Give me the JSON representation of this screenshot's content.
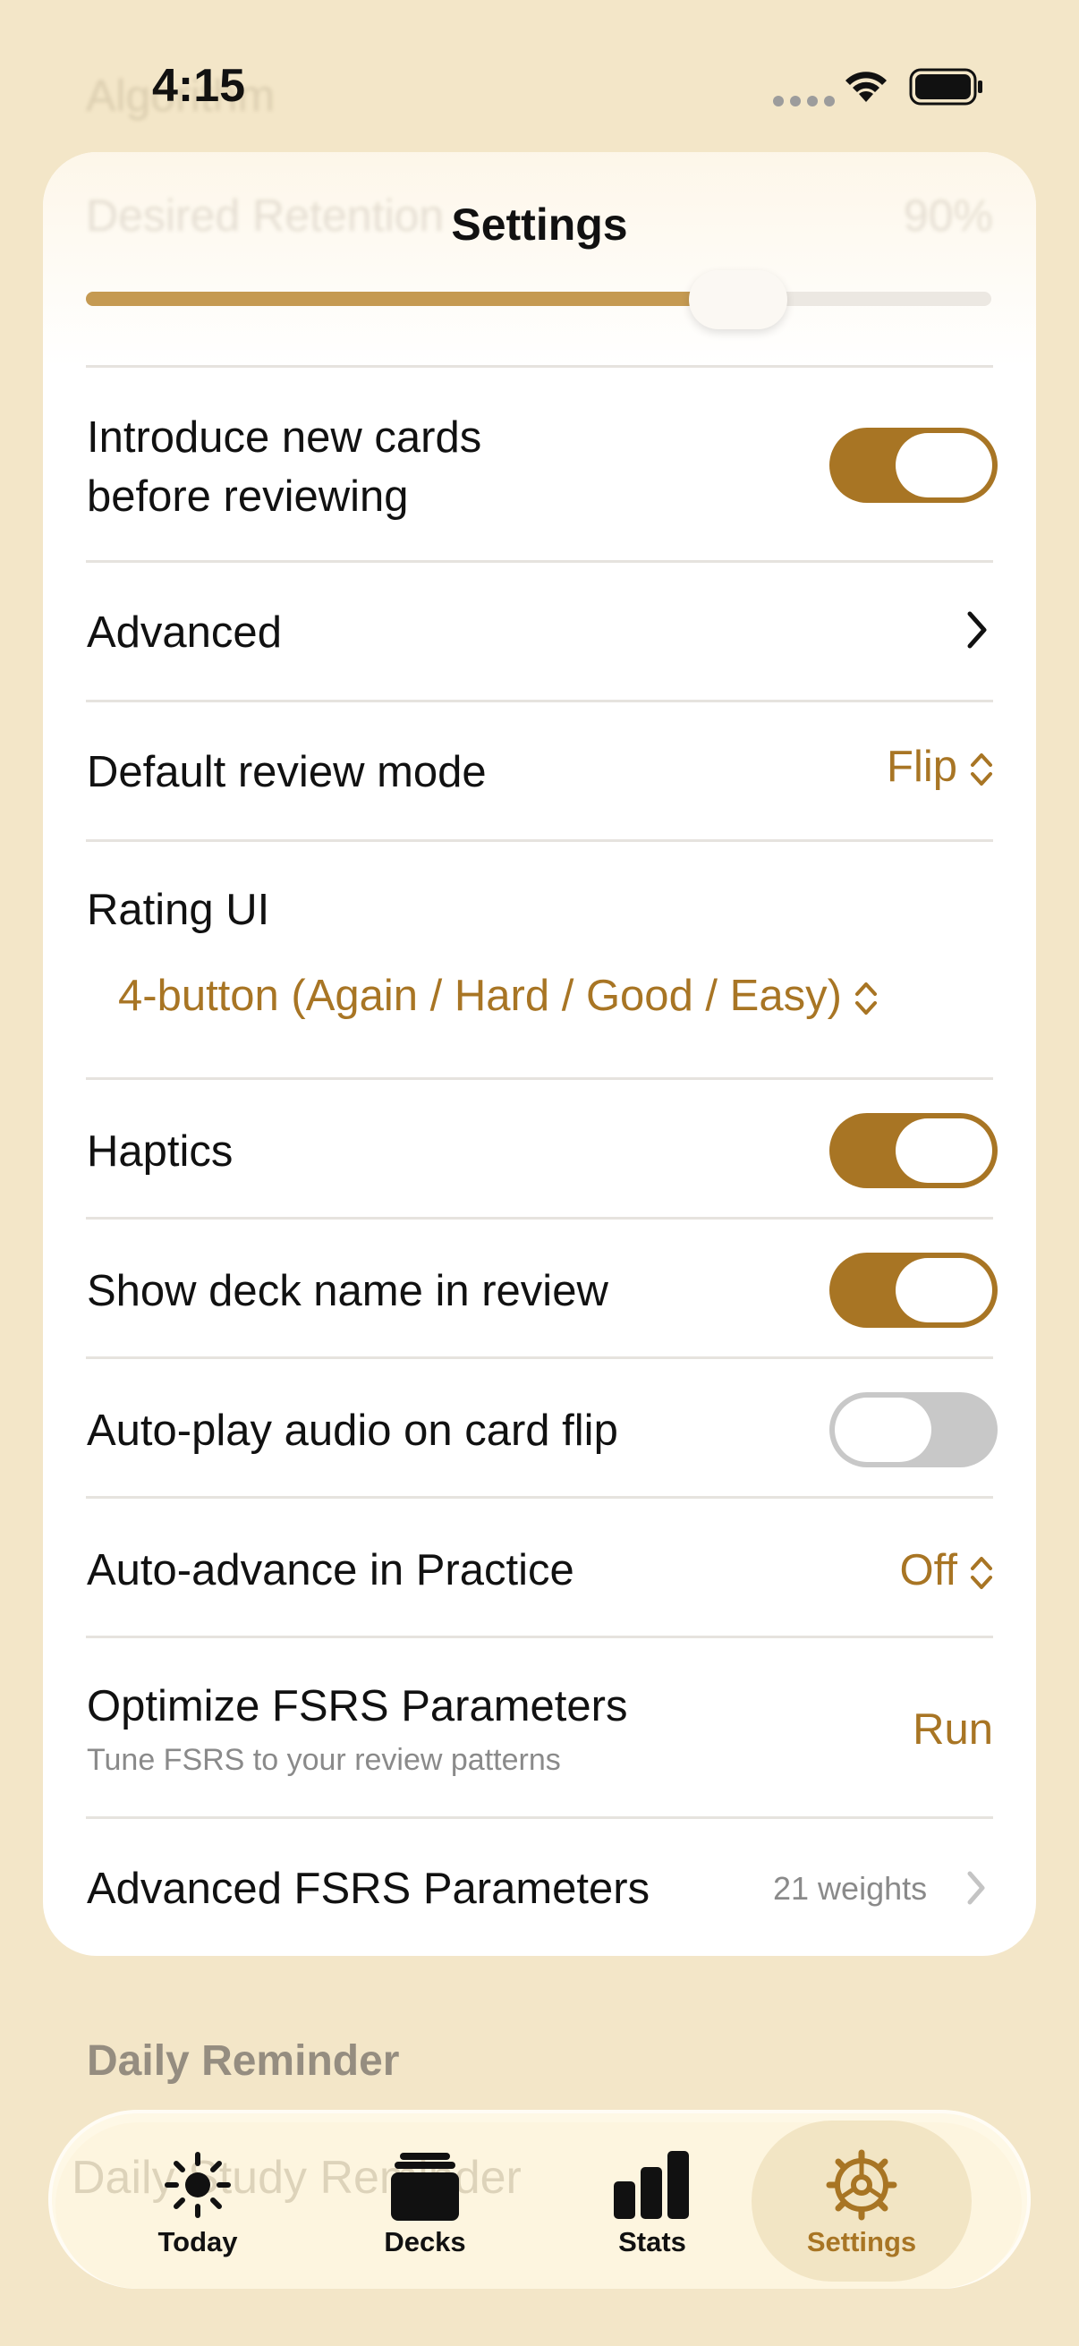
{
  "status_bar": {
    "time": "4:15"
  },
  "background_section": {
    "algorithm_header": "Algorithm",
    "desired_retention_label": "Desired Retention",
    "desired_retention_value": "90%"
  },
  "nav": {
    "title": "Settings"
  },
  "slider": {
    "value_fraction": 0.72
  },
  "rows": {
    "introduce_new": {
      "label_line1": "Introduce new cards",
      "label_line2": "before reviewing",
      "on": true
    },
    "advanced": {
      "label": "Advanced"
    },
    "default_review_mode": {
      "label": "Default review mode",
      "value": "Flip"
    },
    "rating_ui": {
      "label": "Rating UI",
      "value": "4-button (Again / Hard / Good / Easy)"
    },
    "haptics": {
      "label": "Haptics",
      "on": true
    },
    "show_deck_name": {
      "label": "Show deck name in review",
      "on": true
    },
    "auto_play_audio": {
      "label": "Auto-play audio on card flip",
      "on": false
    },
    "auto_advance": {
      "label": "Auto-advance in Practice",
      "value": "Off"
    },
    "optimize_fsrs": {
      "label": "Optimize FSRS Parameters",
      "sublabel": "Tune FSRS to your review patterns",
      "action": "Run"
    },
    "advanced_fsrs": {
      "label": "Advanced FSRS Parameters",
      "detail": "21 weights"
    }
  },
  "daily_reminder": {
    "section_header": "Daily Reminder",
    "row_label": "Daily Study Reminder"
  },
  "tabs": [
    {
      "label": "Today",
      "icon": "sun-icon"
    },
    {
      "label": "Decks",
      "icon": "decks-icon"
    },
    {
      "label": "Stats",
      "icon": "bar-chart-icon"
    },
    {
      "label": "Settings",
      "icon": "gear-icon"
    }
  ],
  "colors": {
    "accent": "#a87524",
    "background": "#f3e6c8",
    "card": "#ffffff"
  }
}
